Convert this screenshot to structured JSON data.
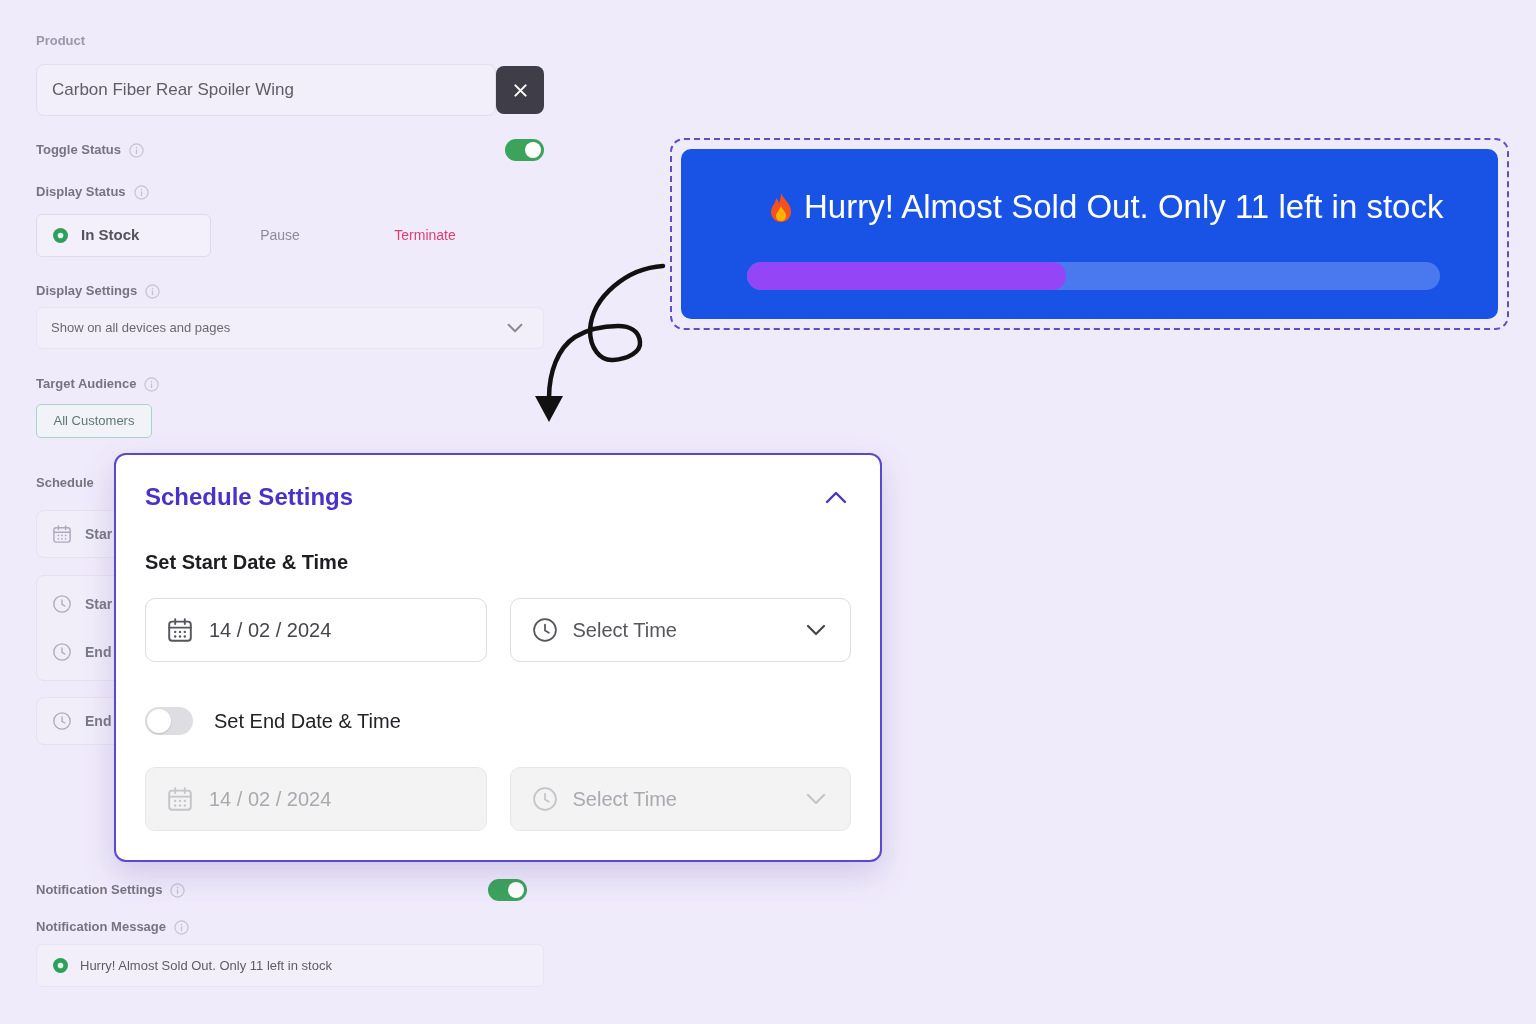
{
  "background_form": {
    "product": {
      "label": "Product",
      "value": "Carbon Fiber Rear Spoiler Wing"
    },
    "toggle_status": {
      "label": "Toggle Status",
      "on": true
    },
    "display_status": {
      "label": "Display Status",
      "options": [
        {
          "label": "In Stock",
          "kind": "success",
          "selected": true
        },
        {
          "label": "Pause",
          "kind": "neutral",
          "selected": false
        },
        {
          "label": "Terminate",
          "kind": "danger",
          "selected": false
        }
      ]
    },
    "display_settings": {
      "label": "Display Settings",
      "value": "Show on all devices and pages"
    },
    "target_audience": {
      "label": "Target Audience",
      "chips": [
        "All Customers"
      ]
    },
    "schedule": {
      "label": "Schedule",
      "groups": [
        {
          "rows": [
            {
              "kind": "date",
              "text": "Star"
            }
          ]
        },
        {
          "rows": [
            {
              "kind": "time",
              "text": "Star"
            },
            {
              "kind": "time",
              "text": "End"
            }
          ]
        },
        {
          "rows": [
            {
              "kind": "time",
              "text": "End"
            }
          ]
        }
      ]
    },
    "notification_settings": {
      "label": "Notification Settings",
      "on": true
    },
    "notification_message": {
      "label": "Notification Message",
      "value": "Hurry! Almost Sold Out. Only 11 left in stock"
    }
  },
  "stock_banner": {
    "message": "Hurry! Almost Sold Out. Only 11 left in stock",
    "level": 0.46
  },
  "schedule_settings": {
    "title": "Schedule Settings",
    "expanded": true,
    "start": {
      "label": "Set Start Date & Time",
      "date": {
        "value": "14 / 02 / 2024",
        "disabled": false
      },
      "time": {
        "prompt": "Select Time",
        "disabled": false
      }
    },
    "end": {
      "label": "Set End Date & Time",
      "on": false,
      "date": {
        "value": "14 / 02 / 2024",
        "disabled": true
      },
      "time": {
        "prompt": "Select Time",
        "disabled": true
      }
    }
  }
}
